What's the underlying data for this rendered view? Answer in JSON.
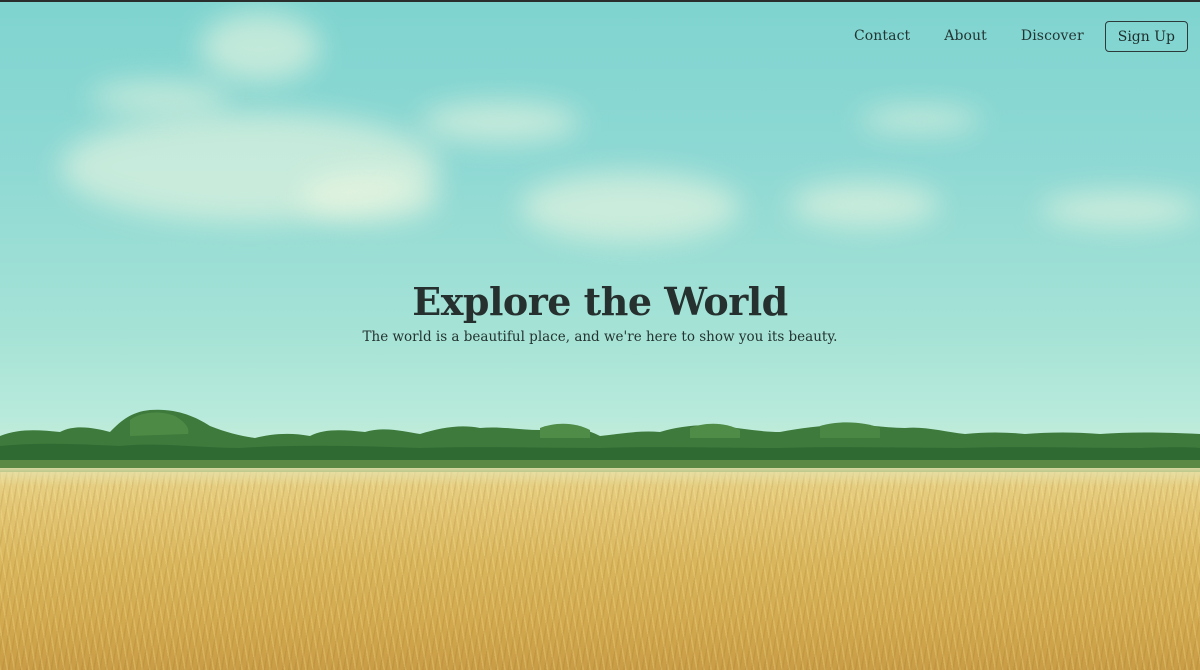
{
  "nav": {
    "links": [
      "Contact",
      "About",
      "Discover"
    ],
    "signup_label": "Sign Up"
  },
  "hero": {
    "title": "Explore the World",
    "subtitle": "The world is a beautiful place, and we're here to show you its beauty."
  },
  "colors": {
    "sky_top": "#7fd4d0",
    "sky_bottom": "#c3ecd9",
    "trees": "#3f7a3c",
    "wheat": "#d9b65c",
    "text": "#26312f"
  }
}
